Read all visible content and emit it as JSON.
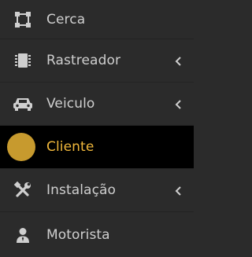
{
  "menu": {
    "items": [
      {
        "label": "Cerca",
        "icon": "crop-square-icon",
        "has_submenu": false
      },
      {
        "label": "Rastreador",
        "icon": "chip-icon",
        "has_submenu": true
      },
      {
        "label": "Veiculo",
        "icon": "car-icon",
        "has_submenu": true
      },
      {
        "label": "Cliente",
        "icon": "avatar-circle",
        "has_submenu": false,
        "active": true
      },
      {
        "label": "Instalação",
        "icon": "tools-icon",
        "has_submenu": true
      },
      {
        "label": "Motorista",
        "icon": "user-icon",
        "has_submenu": false
      }
    ]
  },
  "colors": {
    "background": "#2b2b2b",
    "active_background": "#000000",
    "active_text": "#f0b73b",
    "text": "#cfcfcf",
    "avatar": "#c79a2e"
  }
}
